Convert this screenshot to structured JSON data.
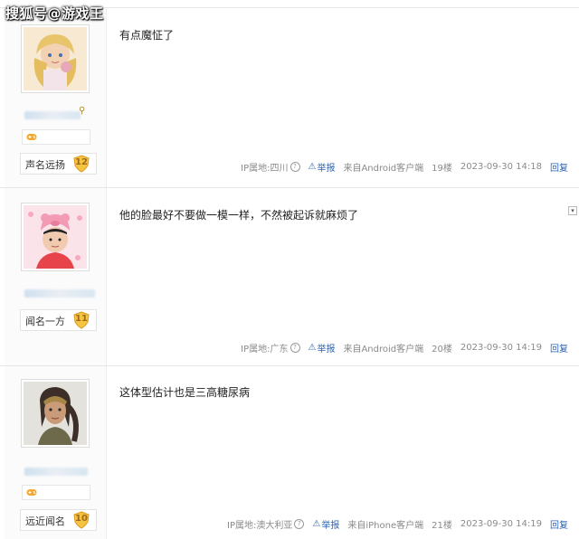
{
  "watermark": "搜狐号@游戏王",
  "posts": [
    {
      "content": "有点魔怔了",
      "badge_icon": "controller-icon",
      "level_name": "声名远扬",
      "level": "12",
      "ip_label": "IP属地:四川",
      "report": "举报",
      "source": "来自Android客户端",
      "floor": "19楼",
      "time": "2023-09-30 14:18",
      "reply": "回复"
    },
    {
      "content": "他的脸最好不要做一模一样，不然被起诉就麻烦了",
      "level_name": "闻名一方",
      "level": "11",
      "ip_label": "IP属地:广东",
      "report": "举报",
      "source": "来自Android客户端",
      "floor": "20楼",
      "time": "2023-09-30 14:19",
      "reply": "回复"
    },
    {
      "content": "这体型估计也是三高糖尿病",
      "badge_icon": "controller-icon",
      "level_name": "远近闻名",
      "level": "10",
      "ip_label": "IP属地:澳大利亚",
      "report": "举报",
      "source": "来自iPhone客户端",
      "floor": "21楼",
      "time": "2023-09-30 14:19",
      "reply": "回复"
    }
  ],
  "colors": {
    "link": "#2d64b3",
    "meta": "#8a8a8a",
    "level_badge": "#f5c542"
  }
}
